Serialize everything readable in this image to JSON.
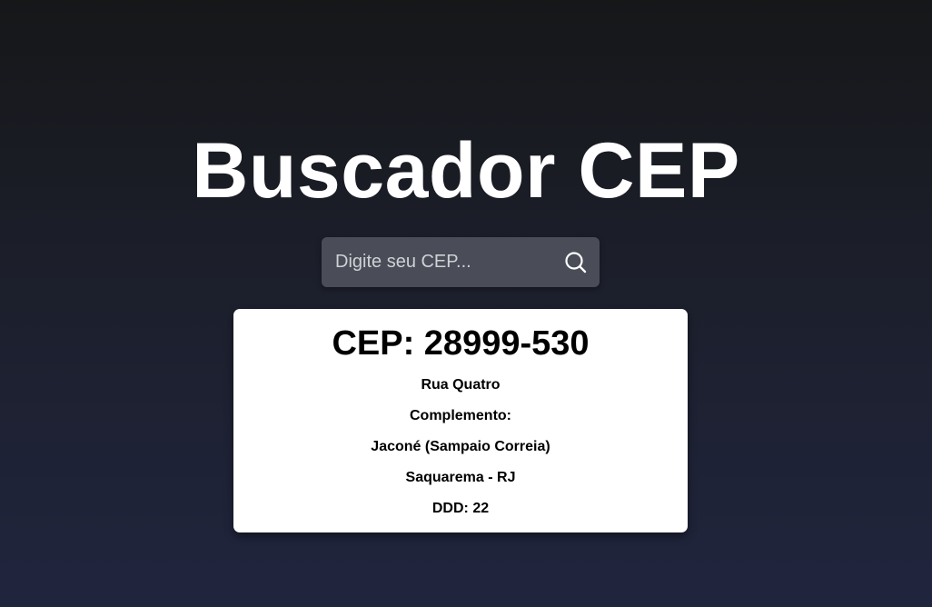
{
  "header": {
    "title": "Buscador CEP"
  },
  "search": {
    "placeholder": "Digite seu CEP...",
    "value": "",
    "icon": "search-icon"
  },
  "result": {
    "cep_label": "CEP: 28999-530",
    "street": "Rua Quatro",
    "complement": "Complemento:",
    "neighborhood": "Jaconé (Sampaio Correia)",
    "city_state": "Saquarema - RJ",
    "ddd": "DDD: 22"
  },
  "colors": {
    "background_top": "#161719",
    "background_bottom": "#20253e",
    "search_bg": "#4a4c57",
    "card_bg": "#ffffff"
  }
}
